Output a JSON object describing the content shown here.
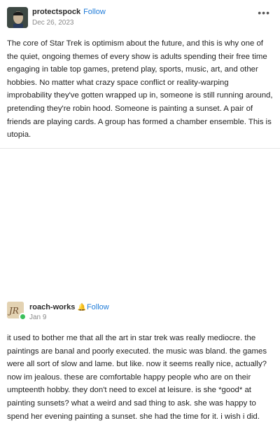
{
  "post1": {
    "username": "protectspock",
    "follow_label": "Follow",
    "date": "Dec 26, 2023",
    "more_label": "•••",
    "body": "The core of Star Trek is optimism about the future, and this is why one of the quiet, ongoing themes of every show is adults spending their free time engaging in table top games, pretend play, sports, music, art, and other hobbies. No matter what crazy space conflict or reality-warping improbability they've gotten wrapped up in, someone is still running around, pretending they're robin hood. Someone is painting a sunset. A pair of friends are playing cards. A group has formed a chamber ensemble. This is utopia."
  },
  "post2": {
    "username": "roach-works",
    "follow_label": "Follow",
    "date": "Jan 9",
    "body": "it used to bother me that all the art in star trek was really mediocre. the paintings are banal and poorly executed. the music was bland. the games were all sort of slow and lame. but like. now it seems really nice, actually? now im jealous. these are comfortable happy people who are on their umpteenth hobby. they don't need to excel at leisure. is she *good* at painting sunsets? what a weird and sad thing to ask. she was happy to spend her evening painting a sunset. she had the time for it. i wish i did."
  },
  "icons": {
    "post1_avatar": "spock-avatar",
    "post2_avatar": "roach-avatar",
    "online_indicator": "online-dot",
    "follow_bell": "bell-icon",
    "more": "more-options-icon"
  },
  "colors": {
    "follow": "#1f7bd8",
    "online": "#3bbf5a",
    "date": "#8a8a8a"
  }
}
